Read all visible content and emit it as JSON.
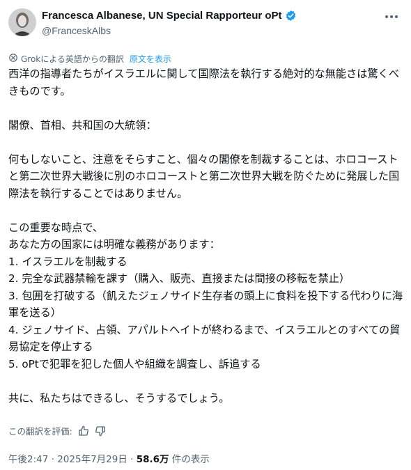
{
  "author": {
    "name": "Francesca Albanese, UN Special Rapporteur oPt",
    "handle": "@FranceskAlbs"
  },
  "translation": {
    "label": "Grokによる英語からの翻訳",
    "show_original": "原文を表示"
  },
  "tweet": {
    "text": "西洋の指導者たちがイスラエルに関して国際法を執行する絶対的な無能さは驚くべきものです。\n\n閣僚、首相、共和国の大統領：\n\n何もしないこと、注意をそらすこと、個々の閣僚を制裁することは、ホロコーストと第二次世界大戦後に別のホロコーストと第二次世界大戦を防ぐために発展した国際法を執行することではありません。\n\nこの重要な時点で、\nあなた方の国家には明確な義務があります：\n1. イスラエルを制裁する\n2. 完全な武器禁輸を課す（購入、販売、直接または間接の移転を禁止）\n3. 包囲を打破する（飢えたジェノサイド生存者の頭上に食料を投下する代わりに海軍を送る）\n4. ジェノサイド、占領、アパルトヘイトが終わるまで、イスラエルとのすべての貿易協定を停止する\n5. oPtで犯罪を犯した個人や組織を調査し、訴追する\n\n共に、私たちはできるし、そうするでしょう。"
  },
  "rating": {
    "label": "この翻訳を評価:"
  },
  "meta": {
    "time": "午後2:47",
    "separator": "·",
    "date": "2025年7月29日",
    "views_count": "58.6万",
    "views_label": "件の表示"
  },
  "colors": {
    "text": "#0f1419",
    "secondary": "#536471",
    "link": "#1d9bf0",
    "verified": "#1d9bf0"
  },
  "icons": [
    "avatar",
    "verified-badge-icon",
    "more-icon",
    "translate-icon",
    "thumbs-up-icon",
    "thumbs-down-icon"
  ]
}
